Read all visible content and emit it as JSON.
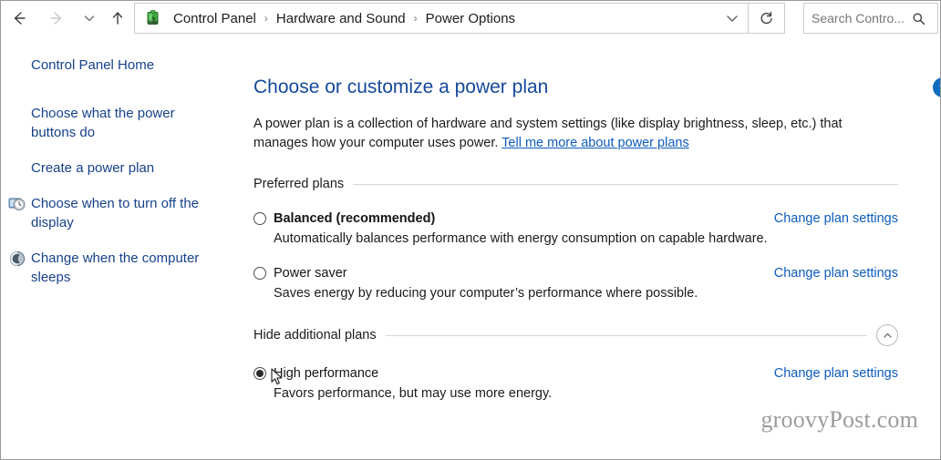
{
  "window": {
    "nav": {
      "back_icon": "arrow-left-icon",
      "forward_icon": "arrow-right-icon",
      "recent_icon": "chevron-down-icon",
      "up_icon": "arrow-up-icon",
      "refresh_icon": "refresh-icon",
      "refresh_label": "↻",
      "dropdown_icon": "chevron-down-icon"
    },
    "breadcrumb": {
      "icon": "power-battery-icon",
      "separator": "›",
      "items": [
        "Control Panel",
        "Hardware and Sound",
        "Power Options"
      ]
    },
    "search": {
      "value": "",
      "placeholder": "Search Contro...",
      "icon": "search-icon"
    }
  },
  "sidebar": {
    "items": [
      {
        "label": "Control Panel Home",
        "icon": null
      },
      {
        "label": "Choose what the power buttons do",
        "icon": null
      },
      {
        "label": "Create a power plan",
        "icon": null
      },
      {
        "label": "Choose when to turn off the display",
        "icon": "display-clock-icon"
      },
      {
        "label": "Change when the computer sleeps",
        "icon": "sleep-moon-icon"
      }
    ]
  },
  "main": {
    "title": "Choose or customize a power plan",
    "intro_part1": "A power plan is a collection of hardware and system settings (like display brightness, sleep, etc.) that manages how your computer uses power. ",
    "intro_link": "Tell me more about power plans",
    "help_label": "?",
    "sections": [
      {
        "label": "Preferred plans",
        "collapse_icon": null,
        "collapse_label": "",
        "plans": [
          {
            "name": "Balanced (recommended)",
            "bold": true,
            "selected": false,
            "description": "Automatically balances performance with energy consumption on capable hardware.",
            "link": "Change plan settings"
          },
          {
            "name": "Power saver",
            "bold": false,
            "selected": false,
            "description": "Saves energy by reducing your computer’s performance where possible.",
            "link": "Change plan settings"
          }
        ]
      },
      {
        "label": "Hide additional plans",
        "collapse_icon": "chevron-up-icon",
        "collapse_label": "⌃",
        "plans": [
          {
            "name": "High performance",
            "bold": false,
            "selected": true,
            "description": "Favors performance, but may use more energy.",
            "link": "Change plan settings"
          }
        ]
      }
    ]
  },
  "watermark": "groovyPost.com",
  "colors": {
    "link_blue": "#0d5bbd",
    "title_blue": "#15499b",
    "sidebar_blue": "#16418b",
    "help_blue": "#0f6cbd",
    "rule_grey": "#d6d6d6"
  }
}
